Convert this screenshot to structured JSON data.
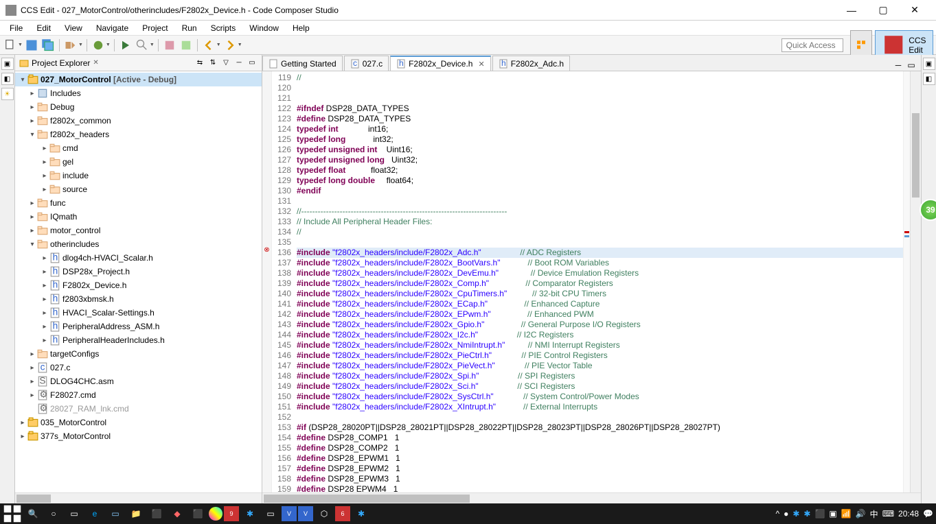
{
  "window": {
    "title": "CCS Edit - 027_MotorControl/otherincludes/F2802x_Device.h - Code Composer Studio"
  },
  "menu": [
    "File",
    "Edit",
    "View",
    "Navigate",
    "Project",
    "Run",
    "Scripts",
    "Window",
    "Help"
  ],
  "toolbar": {
    "quick_access": "Quick Access",
    "perspective_label": "CCS Edit"
  },
  "explorer": {
    "title": "Project Explorer",
    "tree": [
      {
        "d": 0,
        "exp": "▾",
        "icon": "project",
        "label": "027_MotorControl",
        "ctx": "  [Active - Debug]",
        "bold": true,
        "sel": true
      },
      {
        "d": 1,
        "exp": "▸",
        "icon": "inc",
        "label": "Includes"
      },
      {
        "d": 1,
        "exp": "▸",
        "icon": "folder",
        "label": "Debug"
      },
      {
        "d": 1,
        "exp": "▸",
        "icon": "folder",
        "label": "f2802x_common"
      },
      {
        "d": 1,
        "exp": "▾",
        "icon": "folder",
        "label": "f2802x_headers"
      },
      {
        "d": 2,
        "exp": "▸",
        "icon": "folder",
        "label": "cmd"
      },
      {
        "d": 2,
        "exp": "▸",
        "icon": "folder",
        "label": "gel"
      },
      {
        "d": 2,
        "exp": "▸",
        "icon": "folder",
        "label": "include"
      },
      {
        "d": 2,
        "exp": "▸",
        "icon": "folder",
        "label": "source"
      },
      {
        "d": 1,
        "exp": "▸",
        "icon": "folder",
        "label": "func"
      },
      {
        "d": 1,
        "exp": "▸",
        "icon": "folder",
        "label": "IQmath"
      },
      {
        "d": 1,
        "exp": "▸",
        "icon": "folder",
        "label": "motor_control"
      },
      {
        "d": 1,
        "exp": "▾",
        "icon": "folder",
        "label": "otherincludes"
      },
      {
        "d": 2,
        "exp": "▸",
        "icon": "h",
        "label": "dlog4ch-HVACI_Scalar.h"
      },
      {
        "d": 2,
        "exp": "▸",
        "icon": "h",
        "label": "DSP28x_Project.h"
      },
      {
        "d": 2,
        "exp": "▸",
        "icon": "h",
        "label": "F2802x_Device.h"
      },
      {
        "d": 2,
        "exp": "▸",
        "icon": "h",
        "label": "f2803xbmsk.h"
      },
      {
        "d": 2,
        "exp": "▸",
        "icon": "h",
        "label": "HVACI_Scalar-Settings.h"
      },
      {
        "d": 2,
        "exp": "▸",
        "icon": "h",
        "label": "PeripheralAddress_ASM.h"
      },
      {
        "d": 2,
        "exp": "▸",
        "icon": "h",
        "label": "PeripheralHeaderIncludes.h"
      },
      {
        "d": 1,
        "exp": "▸",
        "icon": "folder",
        "label": "targetConfigs"
      },
      {
        "d": 1,
        "exp": "▸",
        "icon": "c",
        "label": "027.c"
      },
      {
        "d": 1,
        "exp": "▸",
        "icon": "asm",
        "label": "DLOG4CHC.asm"
      },
      {
        "d": 1,
        "exp": "▸",
        "icon": "cmd",
        "label": "F28027.cmd"
      },
      {
        "d": 1,
        "exp": "",
        "icon": "cmd",
        "label": "28027_RAM_lnk.cmd",
        "gray": true
      },
      {
        "d": 0,
        "exp": "▸",
        "icon": "project",
        "label": "035_MotorControl"
      },
      {
        "d": 0,
        "exp": "▸",
        "icon": "project",
        "label": "377s_MotorControl"
      }
    ]
  },
  "editor": {
    "tabs": [
      {
        "icon": "page",
        "label": "Getting Started",
        "active": false
      },
      {
        "icon": "c",
        "label": "027.c",
        "active": false
      },
      {
        "icon": "h",
        "label": "F2802x_Device.h",
        "active": true,
        "close": true
      },
      {
        "icon": "h",
        "label": "F2802x_Adc.h",
        "active": false
      }
    ],
    "lines": [
      {
        "n": 119,
        "t": "//",
        "cls": "cmt"
      },
      {
        "n": 120,
        "t": ""
      },
      {
        "n": 121,
        "t": ""
      },
      {
        "n": 122,
        "segs": [
          [
            "#ifndef",
            "kw"
          ],
          [
            " DSP28_DATA_TYPES",
            ""
          ]
        ]
      },
      {
        "n": 123,
        "segs": [
          [
            "#define",
            "kw"
          ],
          [
            " DSP28_DATA_TYPES",
            ""
          ]
        ]
      },
      {
        "n": 124,
        "segs": [
          [
            "typedef int",
            "kw"
          ],
          [
            "             int16;",
            ""
          ]
        ]
      },
      {
        "n": 125,
        "segs": [
          [
            "typedef long",
            "kw"
          ],
          [
            "            int32;",
            ""
          ]
        ]
      },
      {
        "n": 126,
        "segs": [
          [
            "typedef unsigned int",
            "kw"
          ],
          [
            "    Uint16;",
            ""
          ]
        ]
      },
      {
        "n": 127,
        "segs": [
          [
            "typedef unsigned long",
            "kw"
          ],
          [
            "   Uint32;",
            ""
          ]
        ]
      },
      {
        "n": 128,
        "segs": [
          [
            "typedef float",
            "kw"
          ],
          [
            "           float32;",
            ""
          ]
        ]
      },
      {
        "n": 129,
        "segs": [
          [
            "typedef long double",
            "kw"
          ],
          [
            "     float64;",
            ""
          ]
        ]
      },
      {
        "n": 130,
        "segs": [
          [
            "#endif",
            "kw"
          ]
        ]
      },
      {
        "n": 131,
        "t": ""
      },
      {
        "n": 132,
        "segs": [
          [
            "//---------------------------------------------------------------------------",
            "cmt"
          ]
        ]
      },
      {
        "n": 133,
        "segs": [
          [
            "// Include All Peripheral Header Files:",
            "cmt"
          ]
        ]
      },
      {
        "n": 134,
        "segs": [
          [
            "//",
            "cmt"
          ]
        ]
      },
      {
        "n": 135,
        "t": ""
      },
      {
        "n": 136,
        "hl": true,
        "err": true,
        "segs": [
          [
            "#include ",
            "kw"
          ],
          [
            "\"f2802x_headers/include/F2802x_Adc.h\"",
            "str"
          ],
          [
            "                 ",
            ""
          ],
          [
            "// ADC Registers",
            "cmt"
          ]
        ]
      },
      {
        "n": 137,
        "segs": [
          [
            "#include ",
            "kw"
          ],
          [
            "\"f2802x_headers/include/F2802x_BootVars.h\"",
            "str"
          ],
          [
            "            ",
            ""
          ],
          [
            "// Boot ROM Variables",
            "cmt"
          ]
        ]
      },
      {
        "n": 138,
        "segs": [
          [
            "#include ",
            "kw"
          ],
          [
            "\"f2802x_headers/include/F2802x_DevEmu.h\"",
            "str"
          ],
          [
            "              ",
            ""
          ],
          [
            "// Device Emulation Registers",
            "cmt"
          ]
        ]
      },
      {
        "n": 139,
        "segs": [
          [
            "#include ",
            "kw"
          ],
          [
            "\"f2802x_headers/include/F2802x_Comp.h\"",
            "str"
          ],
          [
            "                ",
            ""
          ],
          [
            "// Comparator Registers",
            "cmt"
          ]
        ]
      },
      {
        "n": 140,
        "segs": [
          [
            "#include ",
            "kw"
          ],
          [
            "\"f2802x_headers/include/F2802x_CpuTimers.h\"",
            "str"
          ],
          [
            "           ",
            ""
          ],
          [
            "// 32-bit CPU Timers",
            "cmt"
          ]
        ]
      },
      {
        "n": 141,
        "segs": [
          [
            "#include ",
            "kw"
          ],
          [
            "\"f2802x_headers/include/F2802x_ECap.h\"",
            "str"
          ],
          [
            "                ",
            ""
          ],
          [
            "// Enhanced Capture",
            "cmt"
          ]
        ]
      },
      {
        "n": 142,
        "segs": [
          [
            "#include ",
            "kw"
          ],
          [
            "\"f2802x_headers/include/F2802x_EPwm.h\"",
            "str"
          ],
          [
            "                ",
            ""
          ],
          [
            "// Enhanced PWM",
            "cmt"
          ]
        ]
      },
      {
        "n": 143,
        "segs": [
          [
            "#include ",
            "kw"
          ],
          [
            "\"f2802x_headers/include/F2802x_Gpio.h\"",
            "str"
          ],
          [
            "                ",
            ""
          ],
          [
            "// General Purpose I/O Registers",
            "cmt"
          ]
        ]
      },
      {
        "n": 144,
        "segs": [
          [
            "#include ",
            "kw"
          ],
          [
            "\"f2802x_headers/include/F2802x_I2c.h\"",
            "str"
          ],
          [
            "                 ",
            ""
          ],
          [
            "// I2C Registers",
            "cmt"
          ]
        ]
      },
      {
        "n": 145,
        "segs": [
          [
            "#include ",
            "kw"
          ],
          [
            "\"f2802x_headers/include/F2802x_NmiIntrupt.h\"",
            "str"
          ],
          [
            "          ",
            ""
          ],
          [
            "// NMI Interrupt Registers",
            "cmt"
          ]
        ]
      },
      {
        "n": 146,
        "segs": [
          [
            "#include ",
            "kw"
          ],
          [
            "\"f2802x_headers/include/F2802x_PieCtrl.h\"",
            "str"
          ],
          [
            "             ",
            ""
          ],
          [
            "// PIE Control Registers",
            "cmt"
          ]
        ]
      },
      {
        "n": 147,
        "segs": [
          [
            "#include ",
            "kw"
          ],
          [
            "\"f2802x_headers/include/F2802x_PieVect.h\"",
            "str"
          ],
          [
            "             ",
            ""
          ],
          [
            "// PIE Vector Table",
            "cmt"
          ]
        ]
      },
      {
        "n": 148,
        "segs": [
          [
            "#include ",
            "kw"
          ],
          [
            "\"f2802x_headers/include/F2802x_Spi.h\"",
            "str"
          ],
          [
            "                 ",
            ""
          ],
          [
            "// SPI Registers",
            "cmt"
          ]
        ]
      },
      {
        "n": 149,
        "segs": [
          [
            "#include ",
            "kw"
          ],
          [
            "\"f2802x_headers/include/F2802x_Sci.h\"",
            "str"
          ],
          [
            "                 ",
            ""
          ],
          [
            "// SCI Registers",
            "cmt"
          ]
        ]
      },
      {
        "n": 150,
        "segs": [
          [
            "#include ",
            "kw"
          ],
          [
            "\"f2802x_headers/include/F2802x_SysCtrl.h\"",
            "str"
          ],
          [
            "             ",
            ""
          ],
          [
            "// System Control/Power Modes",
            "cmt"
          ]
        ]
      },
      {
        "n": 151,
        "segs": [
          [
            "#include ",
            "kw"
          ],
          [
            "\"f2802x_headers/include/F2802x_XIntrupt.h\"",
            "str"
          ],
          [
            "            ",
            ""
          ],
          [
            "// External Interrupts",
            "cmt"
          ]
        ]
      },
      {
        "n": 152,
        "t": ""
      },
      {
        "n": 153,
        "segs": [
          [
            "#if ",
            "kw"
          ],
          [
            "(DSP28_28020PT||DSP28_28021PT||DSP28_28022PT||DSP28_28023PT||DSP28_28026PT||DSP28_28027PT)",
            ""
          ]
        ]
      },
      {
        "n": 154,
        "segs": [
          [
            "#define",
            "kw"
          ],
          [
            " DSP28_COMP1   1",
            ""
          ]
        ]
      },
      {
        "n": 155,
        "segs": [
          [
            "#define",
            "kw"
          ],
          [
            " DSP28_COMP2   1",
            ""
          ]
        ]
      },
      {
        "n": 156,
        "segs": [
          [
            "#define",
            "kw"
          ],
          [
            " DSP28_EPWM1   1",
            ""
          ]
        ]
      },
      {
        "n": 157,
        "segs": [
          [
            "#define",
            "kw"
          ],
          [
            " DSP28_EPWM2   1",
            ""
          ]
        ]
      },
      {
        "n": 158,
        "segs": [
          [
            "#define",
            "kw"
          ],
          [
            " DSP28_EPWM3   1",
            ""
          ]
        ]
      },
      {
        "n": 159,
        "segs": [
          [
            "#define",
            "kw"
          ],
          [
            " DSP28 EPWM4   1",
            ""
          ]
        ]
      }
    ]
  },
  "taskbar": {
    "time": "20:48",
    "badge": "39"
  }
}
